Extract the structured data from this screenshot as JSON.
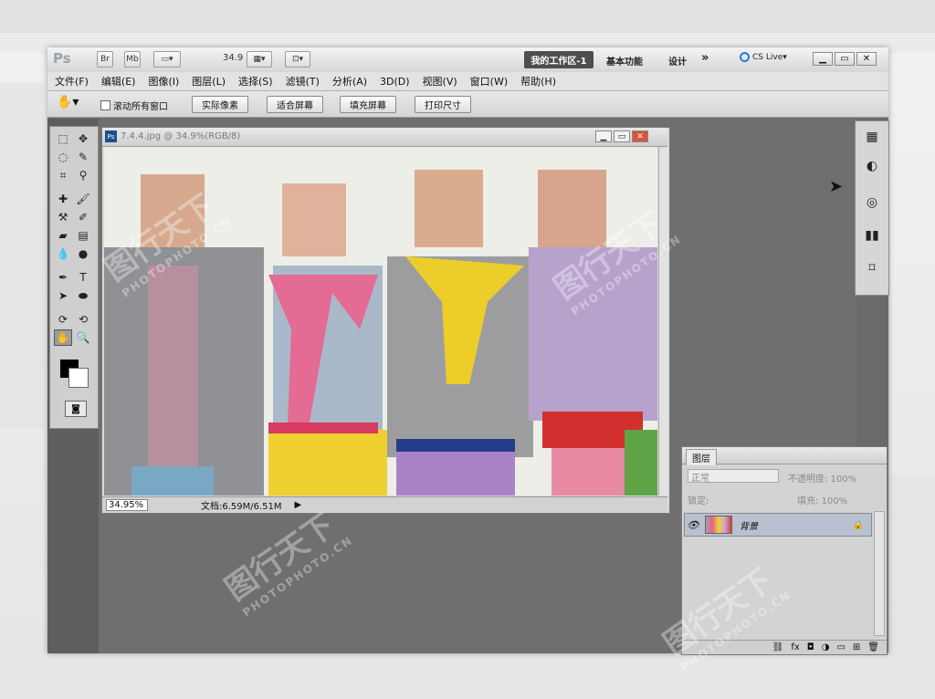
{
  "appbar": {
    "logo": "Ps",
    "btn_br": "Br",
    "btn_mb": "Mb",
    "zoom": "34.9",
    "workspace_active": "我的工作区-1",
    "workspace_basic": "基本功能",
    "workspace_design": "设计",
    "more": "»",
    "cslive": "CS Live▾"
  },
  "menu": [
    "文件(F)",
    "编辑(E)",
    "图像(I)",
    "图层(L)",
    "选择(S)",
    "滤镜(T)",
    "分析(A)",
    "3D(D)",
    "视图(V)",
    "窗口(W)",
    "帮助(H)"
  ],
  "options": {
    "scroll_all": "滚动所有窗口",
    "actual_pixels": "实际像素",
    "fit_screen": "适合屏幕",
    "fill_screen": "填充屏幕",
    "print_size": "打印尺寸"
  },
  "document": {
    "title": "7.4.4.jpg @ 34.9%(RGB/8)",
    "zoom": "34.95%",
    "doc_info": "文档:6.59M/6.51M"
  },
  "layers": {
    "tab": "图层",
    "blend": "正常",
    "opacity": "不透明度: 100%",
    "lock": "锁定:",
    "fill": "填充: 100%",
    "layer_name": "背景"
  },
  "watermark": {
    "text": "图行天下",
    "url": "PHOTOPHOTO.CN"
  }
}
